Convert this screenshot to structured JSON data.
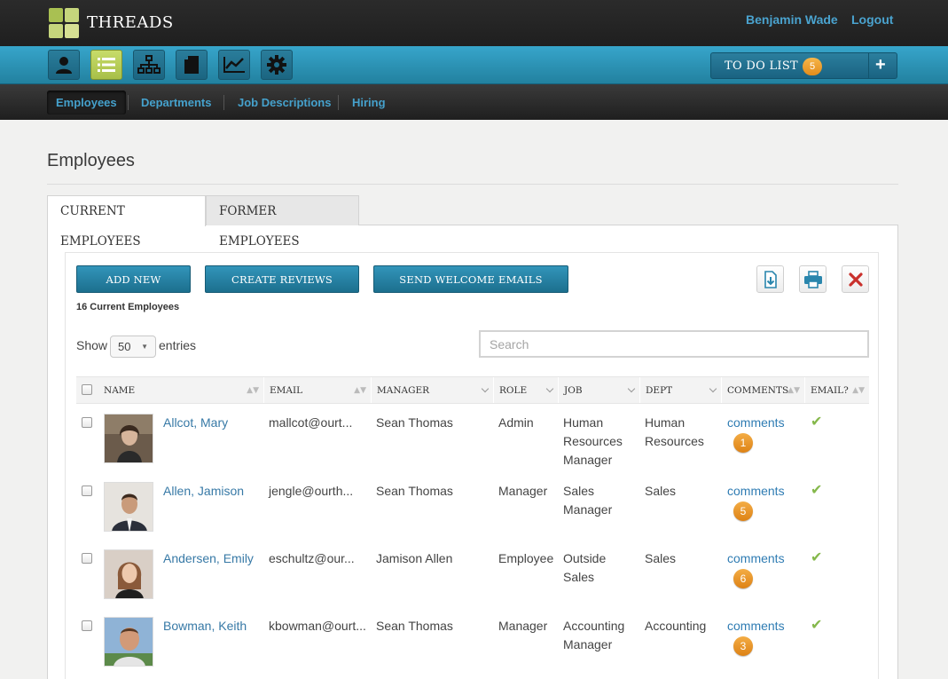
{
  "app": {
    "brand": "THREADS",
    "user_name": "Benjamin Wade",
    "logout": "Logout"
  },
  "toolbar": {
    "icons": [
      "person-icon",
      "list-icon",
      "org-chart-icon",
      "document-icon",
      "chart-icon",
      "gear-icon"
    ],
    "active_icon": "list-icon",
    "todo_label": "TO DO LIST",
    "todo_count": "5",
    "todo_add": "+"
  },
  "subnav": [
    "Employees",
    "Departments",
    "Job Descriptions",
    "Hiring"
  ],
  "page": {
    "title": "Employees"
  },
  "tabs": {
    "current": "CURRENT EMPLOYEES",
    "former": "FORMER EMPLOYEES"
  },
  "actions": {
    "add_new": "ADD NEW",
    "create_reviews": "CREATE REVIEWS",
    "send_emails": "SEND WELCOME EMAILS"
  },
  "tools": {
    "export_icon": "export-icon",
    "print_icon": "print-icon",
    "delete_icon": "delete-icon"
  },
  "count_text": "16 Current Employees",
  "length": {
    "show": "Show",
    "value": "50",
    "entries": "entries"
  },
  "search": {
    "placeholder": "Search"
  },
  "columns": [
    "NAME",
    "EMAIL",
    "MANAGER",
    "ROLE",
    "JOB",
    "DEPT",
    "COMMENTS",
    "EMAIL?"
  ],
  "rows": [
    {
      "name": "Allcot, Mary",
      "email": "mallcot@ourt...",
      "manager": "Sean Thomas",
      "role": "Admin",
      "job": [
        "Human",
        "Resources",
        "Manager"
      ],
      "dept": [
        "Human",
        "Resources"
      ],
      "comments": "comments",
      "count": "1",
      "emailed": "✔"
    },
    {
      "name": "Allen, Jamison",
      "email": "jengle@ourth...",
      "manager": "Sean Thomas",
      "role": "Manager",
      "job": [
        "Sales",
        "Manager"
      ],
      "dept": [
        "Sales"
      ],
      "comments": "comments",
      "count": "5",
      "emailed": "✔"
    },
    {
      "name": "Andersen, Emily",
      "email": "eschultz@our...",
      "manager": "Jamison Allen",
      "role": "Employee",
      "job": [
        "Outside",
        "Sales"
      ],
      "dept": [
        "Sales"
      ],
      "comments": "comments",
      "count": "6",
      "emailed": "✔"
    },
    {
      "name": "Bowman, Keith",
      "email": "kbowman@ourt...",
      "manager": "Sean Thomas",
      "role": "Manager",
      "job": [
        "Accounting",
        "Manager"
      ],
      "dept": [
        "Accounting"
      ],
      "comments": "comments",
      "count": "3",
      "emailed": "✔"
    }
  ],
  "colors": {
    "accent": "#2a8fb5",
    "link": "#3779a6",
    "badge": "#e9962a",
    "check": "#85b84b",
    "active_icon": "#b9cf5b"
  }
}
